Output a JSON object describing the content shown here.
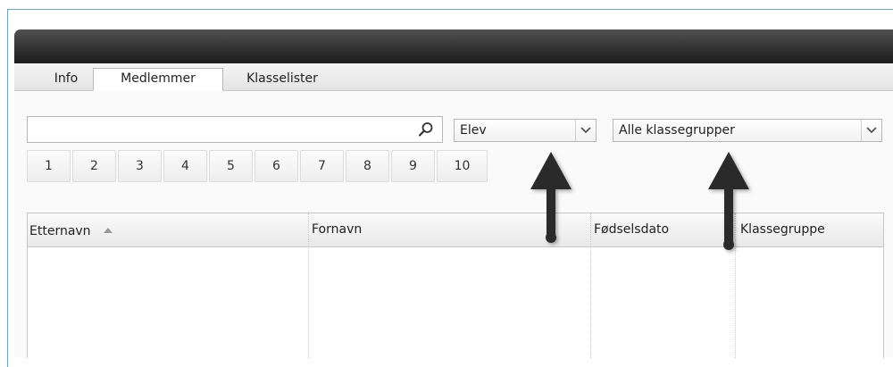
{
  "tabs": [
    {
      "label": "Info"
    },
    {
      "label": "Medlemmer"
    },
    {
      "label": "Klasselister"
    }
  ],
  "search": {
    "value": "",
    "placeholder": ""
  },
  "role_select": {
    "value": "Elev"
  },
  "group_select": {
    "value": "Alle klassegrupper"
  },
  "pager": [
    "1",
    "2",
    "3",
    "4",
    "5",
    "6",
    "7",
    "8",
    "9",
    "10"
  ],
  "grid": {
    "columns": [
      {
        "label": "Etternavn",
        "sort": "ascending"
      },
      {
        "label": "Fornavn"
      },
      {
        "label": "Fødselsdato"
      },
      {
        "label": "Klassegruppe"
      }
    ],
    "rows": []
  },
  "colors": {
    "titlebar": "#2f2f2f",
    "border_accent": "#6fa2d8",
    "arrow": "#2b2b2b"
  },
  "icons": [
    "search-icon",
    "chevron-down-icon",
    "sort-ascending-icon",
    "arrow-up-icon"
  ]
}
